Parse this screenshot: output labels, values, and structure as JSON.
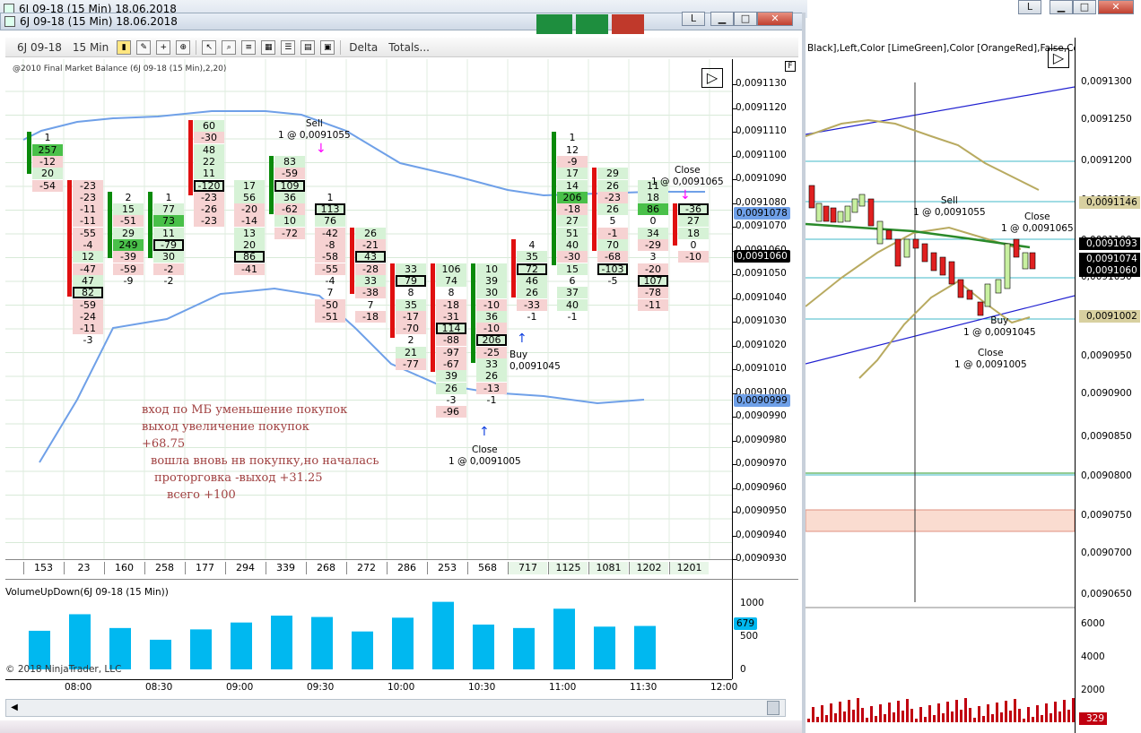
{
  "main_window": {
    "outer_title": "6J 09-18 (15 Min)  18.06.2018",
    "title": "6J 09-18 (15 Min)  18.06.2018",
    "btn_l": "L",
    "btn_min": "▁",
    "btn_max": "□",
    "btn_close": "✕"
  },
  "right_window": {
    "btn_l": "L",
    "btn_min": "▁",
    "btn_max": "□",
    "btn_close": "✕"
  },
  "toolbar": {
    "instrument": "6J 09-18",
    "interval": "15 Min",
    "delta_label": "Delta",
    "totals_label": "Totals..."
  },
  "indicator_label": "@2010 Final Market Balance",
  "indicator_params": "(6J 09-18 (15 Min),2,20)",
  "f_label": "F",
  "price_axis": [
    "0,0091130",
    "0,0091120",
    "0,0091110",
    "0,0091100",
    "0,0091090",
    "0,0091080",
    "0,0091070",
    "0,0091060",
    "0,0091050",
    "0,0091040",
    "0,0091030",
    "0,0091020",
    "0,0091010",
    "0,0091000",
    "0,0090990",
    "0,0090980",
    "0,0090970",
    "0,0090960",
    "0,0090950",
    "0,0090940",
    "0,0090930"
  ],
  "price_tags": {
    "upper": "0,0091078",
    "last": "0,0091060",
    "lower": "0,0090999"
  },
  "trade_labels": {
    "sell1_title": "Sell",
    "sell1_price": "1 @ 0,0091055",
    "close1_title": "Close",
    "close1_price": "1 @ 0,0091005",
    "buy1_title": "Buy",
    "buy1_price": "0,0091045",
    "close2_title": "Close",
    "close2_price": "1 @ 0,0091065"
  },
  "totals": [
    "153",
    "23",
    "160",
    "258",
    "177",
    "294",
    "339",
    "268",
    "272",
    "286",
    "253",
    "568",
    "717",
    "1125",
    "1081",
    "1202",
    "1201"
  ],
  "notes": {
    "l1": "вход по МБ уменьшение покупок",
    "l2": "выход увеличение покупок",
    "l3": "+68.75",
    "l4": "вошла вновь нв покупку,но началась",
    "l5": "проторговка -выход +31.25",
    "l6": "всего +100"
  },
  "volume": {
    "label": "VolumeUpDown(6J 09-18 (15 Min))",
    "copyright": "© 2018 NinjaTrader, LLC",
    "axis": [
      "1000",
      "500",
      "0"
    ],
    "tag": "679",
    "values": [
      560,
      800,
      600,
      430,
      580,
      680,
      780,
      760,
      550,
      750,
      980,
      650,
      600,
      880,
      620,
      630
    ],
    "color": "#00b8f0"
  },
  "time_axis": [
    "08:00",
    "08:30",
    "09:00",
    "09:30",
    "10:00",
    "10:30",
    "11:00",
    "11:30",
    "12:00"
  ],
  "right_chart": {
    "header_text": "Black],Left,Color [LimeGreen],Color [OrangeRed],False,Color [F",
    "axis": [
      "0,0091300",
      "0,0091250",
      "0,0091200",
      "0,0091150",
      "0,0091100",
      "0,0091050",
      "0,0090950",
      "0,0090900",
      "0,0090850",
      "0,0090800",
      "0,0090750",
      "0,0090700",
      "0,0090650"
    ],
    "tags": {
      "t1": "0,0091146",
      "t2": "0,0091093",
      "t3": "0,0091074",
      "t4": "0,0091060",
      "t5": "0,0091002"
    },
    "vol_axis": [
      "6000",
      "4000",
      "2000"
    ],
    "vol_tag": "329",
    "sell_title": "Sell",
    "sell_price": "1 @ 0,0091055",
    "close_title": "Close",
    "close_price": "1 @ 0,0091065",
    "buy_title": "Buy",
    "buy_price": "1 @ 0,0091045",
    "close2_title": "Close",
    "close2_price": "1 @ 0,0091005"
  },
  "columns": [
    {
      "bar": "g",
      "cells": [
        [
          "1",
          "w"
        ],
        [
          "257",
          "G"
        ],
        [
          "-12",
          "r"
        ],
        [
          "20",
          "g"
        ],
        [
          "-54",
          "r"
        ]
      ]
    },
    {
      "bar": "r",
      "cells": [
        [
          "-23",
          "r"
        ],
        [
          "-23",
          "r"
        ],
        [
          "-11",
          "r"
        ],
        [
          "-11",
          "r"
        ],
        [
          "-55",
          "r"
        ],
        [
          "-4",
          "r"
        ],
        [
          "12",
          "g"
        ],
        [
          "-47",
          "r"
        ],
        [
          "47",
          "g"
        ],
        [
          "82",
          "B"
        ],
        [
          "-59",
          "r"
        ],
        [
          "-24",
          "r"
        ],
        [
          "-11",
          "r"
        ],
        [
          "-3",
          "w"
        ]
      ]
    },
    {
      "bar": "g",
      "cells": [
        [
          "2",
          "w"
        ],
        [
          "15",
          "g"
        ],
        [
          "-51",
          "r"
        ],
        [
          "29",
          "g"
        ],
        [
          "249",
          "G"
        ],
        [
          "-39",
          "r"
        ],
        [
          "-59",
          "r"
        ],
        [
          "-9",
          "w"
        ]
      ]
    },
    {
      "bar": "g",
      "cells": [
        [
          "1",
          "w"
        ],
        [
          "77",
          "g"
        ],
        [
          "73",
          "G"
        ],
        [
          "11",
          "g"
        ],
        [
          "-79",
          "B"
        ],
        [
          "30",
          "g"
        ],
        [
          "-2",
          "r"
        ],
        [
          "-2",
          "w"
        ]
      ]
    },
    {
      "bar": "r",
      "cells": [
        [
          "60",
          "g"
        ],
        [
          "-30",
          "r"
        ],
        [
          "48",
          "g"
        ],
        [
          "22",
          "g"
        ],
        [
          "11",
          "g"
        ],
        [
          "-120",
          "B"
        ],
        [
          "-23",
          "r"
        ],
        [
          "-26",
          "r"
        ],
        [
          "-23",
          "r"
        ]
      ]
    },
    {
      "bar": "",
      "cells": [
        [
          "17",
          "g"
        ],
        [
          "56",
          "g"
        ],
        [
          "-20",
          "r"
        ],
        [
          "-14",
          "r"
        ],
        [
          "13",
          "g"
        ],
        [
          "20",
          "g"
        ],
        [
          "86",
          "B"
        ],
        [
          "-41",
          "r"
        ]
      ]
    },
    {
      "bar": "g",
      "cells": [
        [
          "83",
          "g"
        ],
        [
          "-59",
          "r"
        ],
        [
          "109",
          "B"
        ],
        [
          "36",
          "g"
        ],
        [
          "-62",
          "r"
        ],
        [
          "10",
          "g"
        ],
        [
          "-72",
          "r"
        ]
      ]
    },
    {
      "bar": "",
      "cells": [
        [
          "1",
          "w"
        ],
        [
          "113",
          "B"
        ],
        [
          "76",
          "g"
        ],
        [
          "-42",
          "r"
        ],
        [
          "-8",
          "r"
        ],
        [
          "-58",
          "r"
        ],
        [
          "-55",
          "r"
        ],
        [
          "-4",
          "w"
        ],
        [
          "7",
          "w"
        ],
        [
          "-50",
          "r"
        ],
        [
          "-51",
          "r"
        ]
      ]
    },
    {
      "bar": "r",
      "cells": [
        [
          "26",
          "g"
        ],
        [
          "-21",
          "r"
        ],
        [
          "43",
          "B"
        ],
        [
          "-28",
          "r"
        ],
        [
          "33",
          "g"
        ],
        [
          "-38",
          "r"
        ],
        [
          "7",
          "w"
        ],
        [
          "-18",
          "r"
        ]
      ]
    },
    {
      "bar": "r",
      "cells": [
        [
          "33",
          "g"
        ],
        [
          "79",
          "B"
        ],
        [
          "8",
          "w"
        ],
        [
          "35",
          "g"
        ],
        [
          "-17",
          "r"
        ],
        [
          "-70",
          "r"
        ],
        [
          "2",
          "w"
        ],
        [
          "21",
          "g"
        ],
        [
          "-77",
          "r"
        ]
      ]
    },
    {
      "bar": "r",
      "cells": [
        [
          "106",
          "g"
        ],
        [
          "74",
          "g"
        ],
        [
          "8",
          "w"
        ],
        [
          "-18",
          "r"
        ],
        [
          "-31",
          "r"
        ],
        [
          "114",
          "B"
        ],
        [
          "-88",
          "r"
        ],
        [
          "-97",
          "r"
        ],
        [
          "-67",
          "r"
        ],
        [
          "39",
          "g"
        ],
        [
          "26",
          "g"
        ],
        [
          "-3",
          "w"
        ],
        [
          "-96",
          "r"
        ]
      ]
    },
    {
      "bar": "g",
      "cells": [
        [
          "10",
          "g"
        ],
        [
          "39",
          "g"
        ],
        [
          "30",
          "g"
        ],
        [
          "-10",
          "r"
        ],
        [
          "36",
          "g"
        ],
        [
          "-10",
          "r"
        ],
        [
          "206",
          "B"
        ],
        [
          "-25",
          "r"
        ],
        [
          "33",
          "g"
        ],
        [
          "26",
          "g"
        ],
        [
          "-13",
          "r"
        ],
        [
          "-1",
          "w"
        ]
      ]
    },
    {
      "bar": "r",
      "cells": [
        [
          "4",
          "w"
        ],
        [
          "35",
          "g"
        ],
        [
          "72",
          "B"
        ],
        [
          "46",
          "g"
        ],
        [
          "26",
          "g"
        ],
        [
          "-33",
          "r"
        ],
        [
          "-1",
          "w"
        ]
      ]
    },
    {
      "bar": "g",
      "cells": [
        [
          "1",
          "w"
        ],
        [
          "12",
          "w"
        ],
        [
          "-9",
          "r"
        ],
        [
          "17",
          "g"
        ],
        [
          "14",
          "g"
        ],
        [
          "206",
          "G"
        ],
        [
          "-18",
          "r"
        ],
        [
          "27",
          "g"
        ],
        [
          "51",
          "g"
        ],
        [
          "40",
          "g"
        ],
        [
          "-30",
          "r"
        ],
        [
          "15",
          "g"
        ],
        [
          "6",
          "w"
        ],
        [
          "37",
          "g"
        ],
        [
          "40",
          "g"
        ],
        [
          "-1",
          "w"
        ]
      ]
    },
    {
      "bar": "r",
      "cells": [
        [
          "29",
          "g"
        ],
        [
          "26",
          "g"
        ],
        [
          "-23",
          "r"
        ],
        [
          "26",
          "g"
        ],
        [
          "5",
          "w"
        ],
        [
          "-1",
          "r"
        ],
        [
          "70",
          "g"
        ],
        [
          "-68",
          "r"
        ],
        [
          "-103",
          "B"
        ],
        [
          "-5",
          "w"
        ]
      ]
    },
    {
      "bar": "",
      "cells": [
        [
          "11",
          "g"
        ],
        [
          "18",
          "g"
        ],
        [
          "86",
          "G"
        ],
        [
          "0",
          "w"
        ],
        [
          "34",
          "g"
        ],
        [
          "-29",
          "r"
        ],
        [
          "3",
          "w"
        ],
        [
          "-20",
          "r"
        ],
        [
          "107",
          "B"
        ],
        [
          "-78",
          "r"
        ],
        [
          "-11",
          "r"
        ]
      ]
    },
    {
      "bar": "r",
      "cells": [
        [
          "-36",
          "B"
        ],
        [
          "27",
          "g"
        ],
        [
          "18",
          "g"
        ],
        [
          "0",
          "w"
        ],
        [
          "-10",
          "r"
        ]
      ]
    }
  ],
  "col_start_price": [
    1,
    5,
    6,
    6,
    0,
    5,
    3,
    6,
    9,
    12,
    12,
    12,
    10,
    1,
    4,
    5,
    7
  ]
}
